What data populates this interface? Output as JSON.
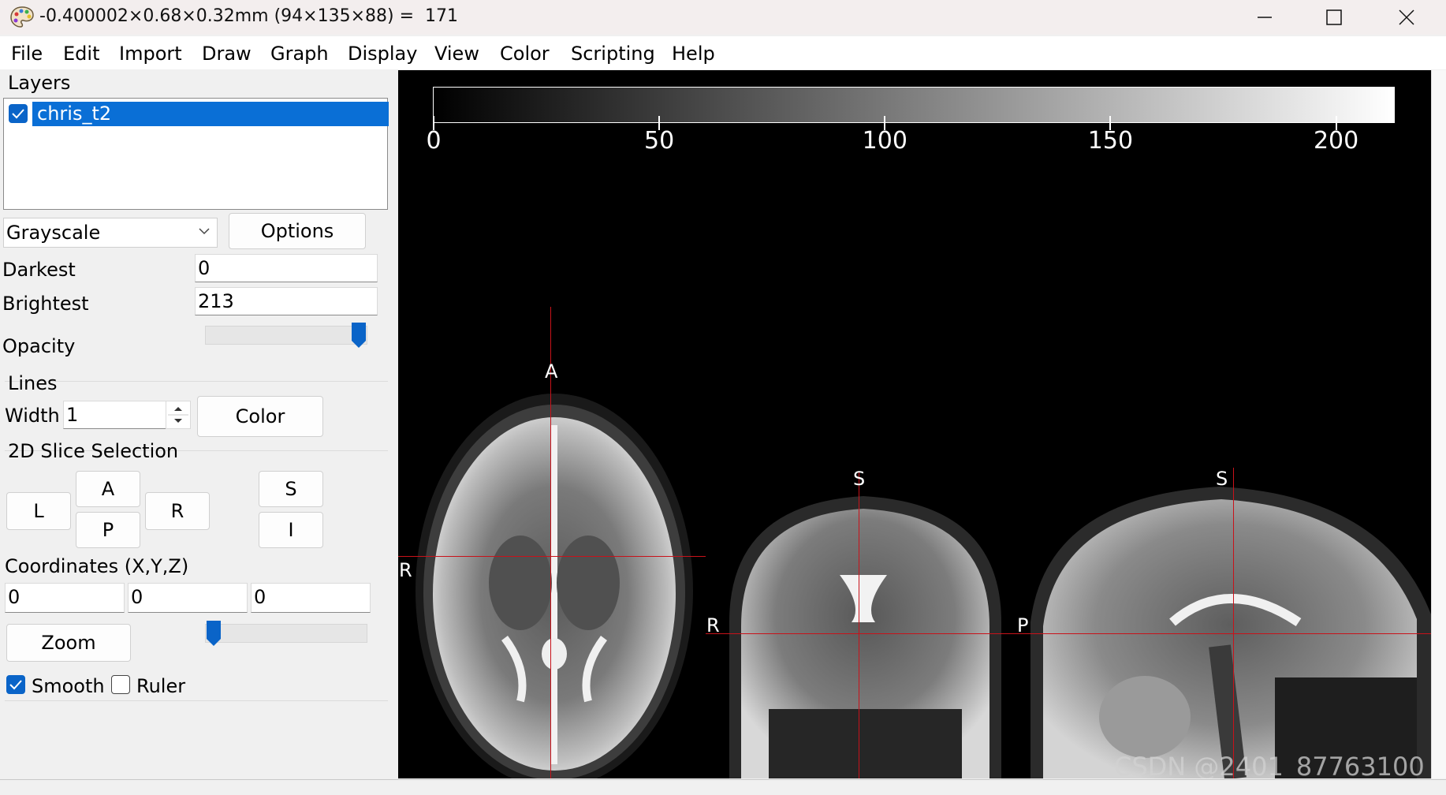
{
  "window": {
    "title": "-0.400002×0.68×0.32mm (94×135×88) =  171",
    "app_icon": "palette-icon"
  },
  "menu": [
    "File",
    "Edit",
    "Import",
    "Draw",
    "Graph",
    "Display",
    "View",
    "Color",
    "Scripting",
    "Help"
  ],
  "sidebar": {
    "layers_title": "Layers",
    "layers": [
      {
        "name": "chris_t2",
        "visible": true,
        "selected": true
      }
    ],
    "colormap": "Grayscale",
    "options_label": "Options",
    "darkest_label": "Darkest",
    "darkest_value": "0",
    "brightest_label": "Brightest",
    "brightest_value": "213",
    "opacity_label": "Opacity",
    "opacity_level": 1.0,
    "lines_title": "Lines",
    "width_label": "Width",
    "width_value": "1",
    "color_label": "Color",
    "slice_title": "2D Slice Selection",
    "slice_buttons": {
      "L": "L",
      "A": "A",
      "P": "P",
      "R": "R",
      "S": "S",
      "I": "I"
    },
    "coords_label": "Coordinates (X,Y,Z)",
    "coord_x": "0",
    "coord_y": "0",
    "coord_z": "0",
    "zoom_label": "Zoom",
    "zoom_level": 0.0,
    "smooth_label": "Smooth",
    "smooth_checked": true,
    "ruler_label": "Ruler",
    "ruler_checked": false
  },
  "viewer": {
    "colorbar": {
      "min": 0,
      "max": 213,
      "ticks": [
        "0",
        "50",
        "100",
        "150",
        "200"
      ],
      "tick_values": [
        0,
        50,
        100,
        150,
        200
      ]
    },
    "axial": {
      "top": "A",
      "left": "R"
    },
    "coronal": {
      "top": "S",
      "left": "R"
    },
    "sagittal": {
      "top": "S",
      "left": "P"
    },
    "crosshair_color": "#c8121a",
    "watermark": "CSDN @2401_87763100"
  }
}
